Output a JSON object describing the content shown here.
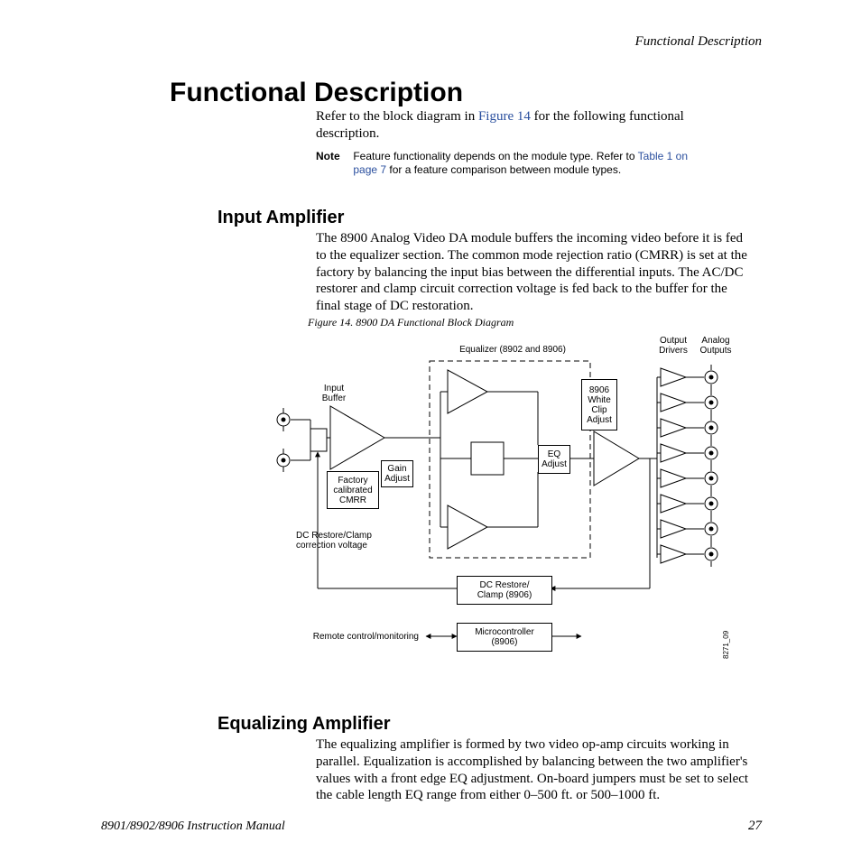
{
  "running_head": "Functional Description",
  "h1": "Functional Description",
  "intro": {
    "pre": "Refer to the block diagram in ",
    "link": "Figure 14",
    "post": " for the following functional description."
  },
  "note": {
    "label": "Note",
    "pre": "Feature functionality depends on the module type. Refer to ",
    "link": "Table 1 on page 7",
    "post": " for a feature comparison between module types."
  },
  "sections": {
    "input": {
      "heading": "Input Amplifier",
      "para": "The 8900 Analog Video DA module buffers the incoming video before it is fed to the equalizer section. The common mode rejection ratio (CMRR) is set at the factory by balancing the input bias between the differential inputs. The AC/DC restorer and clamp circuit correction voltage is fed back to the buffer for the final stage of DC restoration."
    },
    "equalizing": {
      "heading": "Equalizing Amplifier",
      "para": "The equalizing amplifier is formed by two video op-amp circuits working in parallel. Equalization is accomplished by balancing between the two amplifier's values with a front edge EQ adjustment. On-board jumpers must be set to select the cable length EQ range from either 0–500 ft. or 500–1000 ft."
    }
  },
  "figure": {
    "caption": "Figure 14.  8900 DA Functional Block Diagram",
    "labels": {
      "equalizer_top": "Equalizer (8902 and 8906)",
      "output_drivers": "Output\nDrivers",
      "analog_outputs": "Analog\nOutputs",
      "input_buffer": "Input\nBuffer",
      "white_clip": "8906\nWhite\nClip\nAdjust",
      "factory_cmrr": "Factory\ncalibrated\nCMRR",
      "gain_adjust": "Gain\nAdjust",
      "eq_adjust": "EQ\nAdjust",
      "dc_restore_note": "DC Restore/Clamp\ncorrection voltage",
      "dc_restore_box": "DC Restore/\nClamp (8906)",
      "microcontroller": "Microcontroller\n(8906)",
      "remote": "Remote control/monitoring",
      "side_number": "8271_09"
    }
  },
  "footer": {
    "left": "8901/8902/8906 Instruction Manual",
    "page": "27"
  }
}
